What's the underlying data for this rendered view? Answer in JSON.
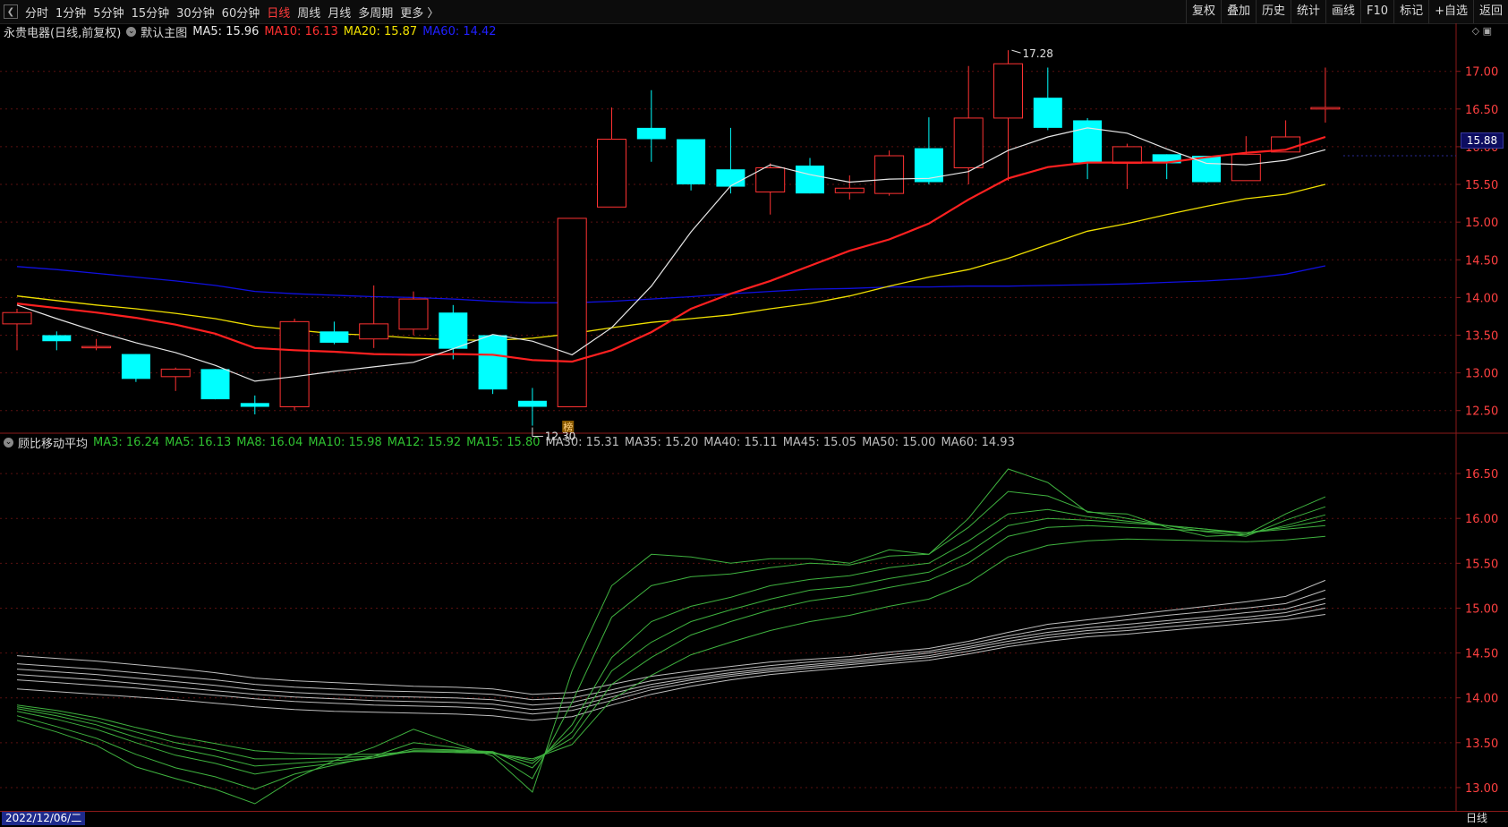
{
  "toolbar": {
    "collapse_icon": "chevron-left-icon",
    "periods": [
      "分时",
      "1分钟",
      "5分钟",
      "15分钟",
      "30分钟",
      "60分钟",
      "日线",
      "周线",
      "月线",
      "多周期",
      "更多 〉"
    ],
    "active_period": "日线",
    "right_buttons": [
      "复权",
      "叠加",
      "历史",
      "统计",
      "画线",
      "F10",
      "标记",
      "+自选",
      "返回"
    ]
  },
  "main_chart": {
    "stock_title": "永贵电器(日线,前复权)",
    "template": "默认主图",
    "ma5": "MA5: 15.96",
    "ma10": "MA10: 16.13",
    "ma20": "MA20: 15.87",
    "ma60": "MA60: 14.42",
    "high_label": "17.28",
    "low_label": "12.30",
    "marker": "榜",
    "current_price": "15.88",
    "y_ticks": [
      "17.00",
      "16.50",
      "16.00",
      "15.50",
      "15.00",
      "14.50",
      "14.00",
      "13.50",
      "13.00",
      "12.50"
    ]
  },
  "indicator": {
    "name": "顾比移动平均",
    "values": [
      "MA3: 16.24",
      "MA5: 16.13",
      "MA8: 16.04",
      "MA10: 15.98",
      "MA12: 15.92",
      "MA15: 15.80",
      "MA30: 15.31",
      "MA35: 15.20",
      "MA40: 15.11",
      "MA45: 15.05",
      "MA50: 15.00",
      "MA60: 14.93"
    ],
    "y_ticks": [
      "16.50",
      "16.00",
      "15.50",
      "15.00",
      "14.50",
      "14.00",
      "13.50",
      "13.00"
    ]
  },
  "status": {
    "date": "2022/12/06/二",
    "period": "日线"
  },
  "colors": {
    "up": "#ff3232",
    "down": "#00ffff",
    "ma5": "#e6e6e6",
    "ma10": "#ff2020",
    "ma20": "#f0e000",
    "ma60": "#1010e0",
    "short_gmma": "#3fb23f",
    "long_gmma": "#bdbdbd"
  },
  "chart_data": {
    "type": "candlestick",
    "price_range": [
      12.2,
      17.4
    ],
    "indicator_range": [
      12.75,
      16.75
    ],
    "candles": [
      {
        "o": 13.65,
        "h": 13.85,
        "l": 13.3,
        "c": 13.8
      },
      {
        "o": 13.5,
        "h": 13.55,
        "l": 13.3,
        "c": 13.42
      },
      {
        "o": 13.35,
        "h": 13.45,
        "l": 13.3,
        "c": 13.35
      },
      {
        "o": 13.25,
        "h": 13.25,
        "l": 12.88,
        "c": 12.92
      },
      {
        "o": 12.95,
        "h": 13.07,
        "l": 12.76,
        "c": 13.05
      },
      {
        "o": 13.05,
        "h": 13.05,
        "l": 12.65,
        "c": 12.65
      },
      {
        "o": 12.6,
        "h": 12.7,
        "l": 12.45,
        "c": 12.55
      },
      {
        "o": 12.55,
        "h": 13.72,
        "l": 12.5,
        "c": 13.68
      },
      {
        "o": 13.55,
        "h": 13.68,
        "l": 13.38,
        "c": 13.4
      },
      {
        "o": 13.45,
        "h": 14.16,
        "l": 13.33,
        "c": 13.65
      },
      {
        "o": 13.58,
        "h": 14.08,
        "l": 13.5,
        "c": 13.98
      },
      {
        "o": 13.8,
        "h": 13.9,
        "l": 13.18,
        "c": 13.32
      },
      {
        "o": 13.5,
        "h": 13.5,
        "l": 12.72,
        "c": 12.78
      },
      {
        "o": 12.63,
        "h": 12.8,
        "l": 12.3,
        "c": 12.55
      },
      {
        "o": 12.55,
        "h": 15.05,
        "l": 12.55,
        "c": 15.05
      },
      {
        "o": 15.2,
        "h": 16.52,
        "l": 15.2,
        "c": 16.1
      },
      {
        "o": 16.25,
        "h": 16.75,
        "l": 15.8,
        "c": 16.1
      },
      {
        "o": 16.1,
        "h": 16.1,
        "l": 15.42,
        "c": 15.5
      },
      {
        "o": 15.7,
        "h": 16.25,
        "l": 15.38,
        "c": 15.47
      },
      {
        "o": 15.4,
        "h": 15.78,
        "l": 15.1,
        "c": 15.72
      },
      {
        "o": 15.75,
        "h": 15.85,
        "l": 15.38,
        "c": 15.38
      },
      {
        "o": 15.39,
        "h": 15.62,
        "l": 15.3,
        "c": 15.45
      },
      {
        "o": 15.38,
        "h": 15.95,
        "l": 15.35,
        "c": 15.88
      },
      {
        "o": 15.98,
        "h": 16.39,
        "l": 15.5,
        "c": 15.53
      },
      {
        "o": 15.72,
        "h": 17.07,
        "l": 15.5,
        "c": 16.38
      },
      {
        "o": 16.38,
        "h": 17.28,
        "l": 15.55,
        "c": 17.1
      },
      {
        "o": 16.65,
        "h": 17.05,
        "l": 16.22,
        "c": 16.25
      },
      {
        "o": 16.35,
        "h": 16.38,
        "l": 15.57,
        "c": 15.79
      },
      {
        "o": 15.78,
        "h": 16.04,
        "l": 15.44,
        "c": 16.0
      },
      {
        "o": 15.9,
        "h": 15.9,
        "l": 15.57,
        "c": 15.78
      },
      {
        "o": 15.88,
        "h": 15.88,
        "l": 15.52,
        "c": 15.53
      },
      {
        "o": 15.55,
        "h": 16.14,
        "l": 15.55,
        "c": 15.9
      },
      {
        "o": 15.93,
        "h": 16.35,
        "l": 15.93,
        "c": 16.13
      },
      {
        "o": 16.5,
        "h": 17.05,
        "l": 16.32,
        "c": 16.52
      }
    ],
    "ma5": [
      13.9,
      13.72,
      13.55,
      13.4,
      13.27,
      13.1,
      12.89,
      12.95,
      13.02,
      13.08,
      13.14,
      13.32,
      13.51,
      13.42,
      13.24,
      13.6,
      14.15,
      14.87,
      15.48,
      15.76,
      15.63,
      15.53,
      15.57,
      15.58,
      15.67,
      15.95,
      16.13,
      16.25,
      16.18,
      15.97,
      15.78,
      15.76,
      15.82,
      15.96
    ],
    "ma10": [
      13.92,
      13.86,
      13.8,
      13.73,
      13.64,
      13.52,
      13.33,
      13.3,
      13.28,
      13.25,
      13.24,
      13.25,
      13.24,
      13.17,
      13.15,
      13.3,
      13.54,
      13.85,
      14.05,
      14.22,
      14.42,
      14.62,
      14.77,
      14.98,
      15.3,
      15.58,
      15.73,
      15.79,
      15.79,
      15.79,
      15.86,
      15.92,
      15.96,
      16.13
    ],
    "ma20": [
      14.02,
      13.96,
      13.9,
      13.85,
      13.79,
      13.72,
      13.62,
      13.57,
      13.52,
      13.5,
      13.46,
      13.44,
      13.43,
      13.46,
      13.52,
      13.6,
      13.67,
      13.72,
      13.77,
      13.85,
      13.92,
      14.02,
      14.15,
      14.27,
      14.37,
      14.52,
      14.7,
      14.88,
      14.98,
      15.1,
      15.21,
      15.31,
      15.37,
      15.5
    ],
    "ma60": [
      14.41,
      14.37,
      14.32,
      14.27,
      14.22,
      14.16,
      14.08,
      14.05,
      14.03,
      14.01,
      14.0,
      13.98,
      13.95,
      13.93,
      13.93,
      13.95,
      13.98,
      14.01,
      14.05,
      14.08,
      14.11,
      14.12,
      14.14,
      14.14,
      14.15,
      14.15,
      14.16,
      14.17,
      14.18,
      14.2,
      14.22,
      14.25,
      14.31,
      14.42
    ],
    "gmma_short": [
      [
        13.75,
        13.62,
        13.47,
        13.23,
        13.1,
        12.98,
        12.82,
        13.1,
        13.3,
        13.45,
        13.65,
        13.5,
        13.35,
        12.95,
        14.3,
        15.25,
        15.6,
        15.57,
        15.5,
        15.55,
        15.55,
        15.5,
        15.65,
        15.6,
        16.0,
        16.55,
        16.4,
        16.07,
        16.05,
        15.9,
        15.8,
        15.82,
        16.05,
        16.24
      ],
      [
        13.8,
        13.68,
        13.55,
        13.37,
        13.22,
        13.12,
        12.98,
        13.15,
        13.25,
        13.35,
        13.5,
        13.45,
        13.38,
        13.1,
        13.95,
        14.9,
        15.25,
        15.35,
        15.38,
        15.45,
        15.5,
        15.48,
        15.58,
        15.6,
        15.9,
        16.3,
        16.25,
        16.08,
        16.0,
        15.92,
        15.85,
        15.8,
        15.98,
        16.13
      ],
      [
        13.85,
        13.76,
        13.65,
        13.5,
        13.36,
        13.27,
        13.15,
        13.22,
        13.27,
        13.33,
        13.43,
        13.42,
        13.4,
        13.22,
        13.7,
        14.45,
        14.85,
        15.02,
        15.12,
        15.25,
        15.32,
        15.36,
        15.45,
        15.5,
        15.75,
        16.05,
        16.1,
        16.02,
        15.97,
        15.92,
        15.88,
        15.82,
        15.92,
        16.04
      ],
      [
        13.88,
        13.8,
        13.7,
        13.56,
        13.44,
        13.35,
        13.24,
        13.27,
        13.3,
        13.33,
        13.41,
        13.41,
        13.39,
        13.27,
        13.62,
        14.3,
        14.62,
        14.85,
        14.98,
        15.1,
        15.2,
        15.24,
        15.33,
        15.4,
        15.62,
        15.92,
        16.0,
        15.98,
        15.95,
        15.92,
        15.88,
        15.84,
        15.9,
        15.98
      ],
      [
        13.9,
        13.83,
        13.74,
        13.62,
        13.5,
        13.42,
        13.32,
        13.32,
        13.33,
        13.35,
        13.4,
        13.4,
        13.39,
        13.3,
        13.55,
        14.15,
        14.45,
        14.7,
        14.85,
        14.98,
        15.08,
        15.14,
        15.23,
        15.31,
        15.5,
        15.8,
        15.9,
        15.92,
        15.9,
        15.88,
        15.86,
        15.84,
        15.88,
        15.92
      ],
      [
        13.92,
        13.86,
        13.78,
        13.67,
        13.57,
        13.49,
        13.41,
        13.38,
        13.37,
        13.37,
        13.4,
        13.39,
        13.38,
        13.32,
        13.48,
        13.98,
        14.25,
        14.48,
        14.62,
        14.75,
        14.85,
        14.92,
        15.02,
        15.1,
        15.28,
        15.57,
        15.7,
        15.75,
        15.77,
        15.76,
        15.75,
        15.74,
        15.76,
        15.8
      ]
    ],
    "gmma_long": [
      [
        14.47,
        14.44,
        14.41,
        14.37,
        14.33,
        14.28,
        14.22,
        14.19,
        14.17,
        14.15,
        14.13,
        14.12,
        14.1,
        14.04,
        14.06,
        14.15,
        14.24,
        14.3,
        14.35,
        14.4,
        14.43,
        14.46,
        14.51,
        14.55,
        14.63,
        14.73,
        14.82,
        14.87,
        14.92,
        14.97,
        15.02,
        15.07,
        15.13,
        15.31
      ],
      [
        14.38,
        14.35,
        14.32,
        14.28,
        14.24,
        14.2,
        14.15,
        14.12,
        14.1,
        14.08,
        14.07,
        14.06,
        14.04,
        13.98,
        14.0,
        14.09,
        14.19,
        14.25,
        14.31,
        14.36,
        14.4,
        14.43,
        14.48,
        14.52,
        14.6,
        14.69,
        14.77,
        14.82,
        14.87,
        14.92,
        14.96,
        15.0,
        15.05,
        15.2
      ],
      [
        14.32,
        14.29,
        14.26,
        14.22,
        14.18,
        14.14,
        14.09,
        14.06,
        14.04,
        14.02,
        14.01,
        14.0,
        13.98,
        13.92,
        13.95,
        14.05,
        14.15,
        14.22,
        14.28,
        14.33,
        14.37,
        14.41,
        14.45,
        14.5,
        14.57,
        14.66,
        14.73,
        14.78,
        14.82,
        14.86,
        14.9,
        14.95,
        14.99,
        15.11
      ],
      [
        14.26,
        14.23,
        14.2,
        14.16,
        14.12,
        14.08,
        14.04,
        14.01,
        13.99,
        13.97,
        13.96,
        13.95,
        13.93,
        13.87,
        13.9,
        14.01,
        14.12,
        14.2,
        14.26,
        14.31,
        14.35,
        14.39,
        14.43,
        14.47,
        14.55,
        14.63,
        14.7,
        14.75,
        14.78,
        14.83,
        14.87,
        14.9,
        14.95,
        15.05
      ],
      [
        14.2,
        14.17,
        14.14,
        14.11,
        14.07,
        14.03,
        13.99,
        13.96,
        13.94,
        13.92,
        13.91,
        13.9,
        13.88,
        13.82,
        13.86,
        13.97,
        14.09,
        14.17,
        14.24,
        14.29,
        14.33,
        14.37,
        14.41,
        14.45,
        14.52,
        14.6,
        14.67,
        14.72,
        14.75,
        14.79,
        14.83,
        14.87,
        14.91,
        15.0
      ],
      [
        14.1,
        14.07,
        14.04,
        14.01,
        13.98,
        13.94,
        13.9,
        13.87,
        13.85,
        13.84,
        13.83,
        13.82,
        13.8,
        13.75,
        13.79,
        13.92,
        14.04,
        14.13,
        14.2,
        14.26,
        14.3,
        14.34,
        14.38,
        14.42,
        14.49,
        14.57,
        14.63,
        14.68,
        14.71,
        14.75,
        14.79,
        14.83,
        14.87,
        14.93
      ]
    ]
  }
}
